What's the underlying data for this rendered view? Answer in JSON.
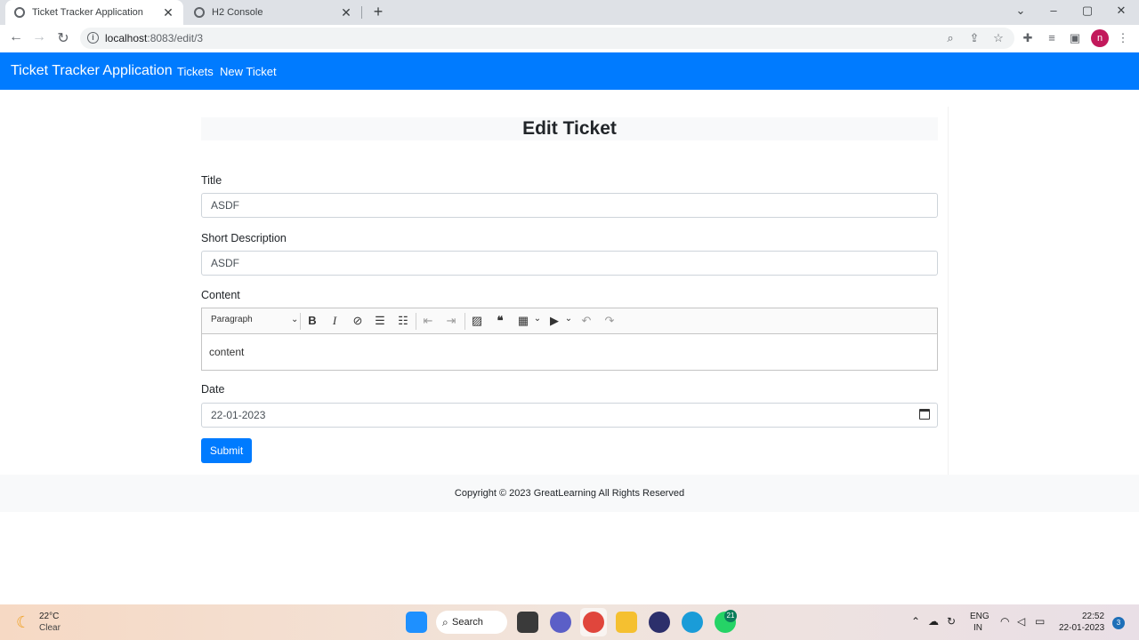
{
  "browser": {
    "tabs": [
      {
        "title": "Ticket Tracker Application",
        "active": true
      },
      {
        "title": "H2 Console",
        "active": false
      }
    ],
    "url_host": "localhost",
    "url_rest": ":8083/edit/3",
    "profile_initial": "n"
  },
  "navbar": {
    "brand": "Ticket Tracker Application",
    "links": [
      "Tickets",
      "New Ticket"
    ]
  },
  "form": {
    "heading": "Edit Ticket",
    "title_label": "Title",
    "title_value": "ASDF",
    "short_desc_label": "Short Description",
    "short_desc_value": "ASDF",
    "content_label": "Content",
    "editor_paragraph": "Paragraph",
    "content_value": "content",
    "date_label": "Date",
    "date_value": "22-01-2023",
    "submit_label": "Submit"
  },
  "footer": {
    "text": "Copyright © 2023 GreatLearning All Rights Reserved"
  },
  "taskbar": {
    "temperature": "22°C",
    "condition": "Clear",
    "search_label": "Search",
    "whatsapp_badge": "21",
    "lang_line1": "ENG",
    "lang_line2": "IN",
    "time": "22:52",
    "date": "22-01-2023",
    "notifications": "3"
  },
  "colors": {
    "primary": "#007bff",
    "profile": "#c2185b"
  }
}
